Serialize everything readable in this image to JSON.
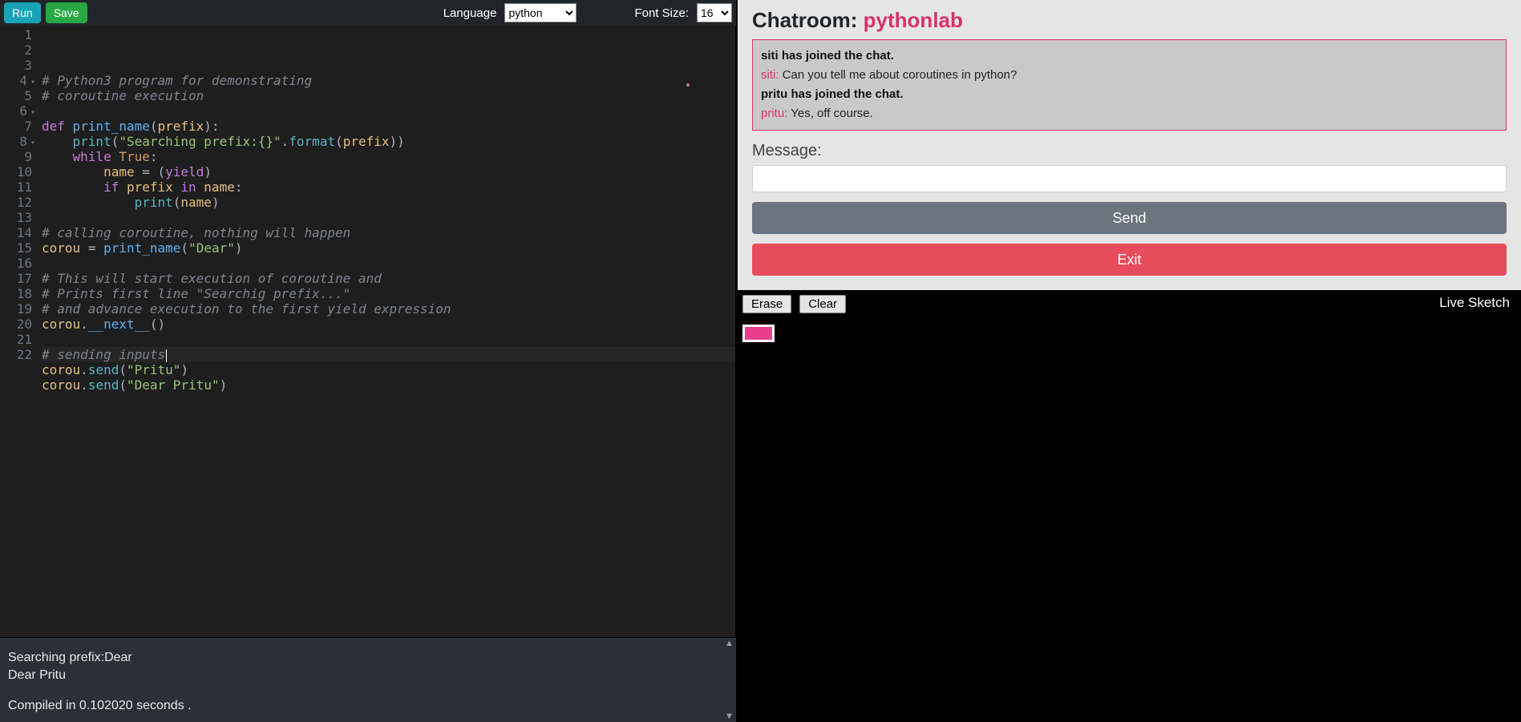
{
  "toolbar": {
    "run_label": "Run",
    "save_label": "Save",
    "language_label": "Language",
    "language_value": "python",
    "fontsize_label": "Font Size:",
    "fontsize_value": "16"
  },
  "editor": {
    "code_lines": [
      {
        "n": 1,
        "fold": false,
        "tokens": [
          [
            "cmt",
            "# Python3 program for demonstrating"
          ]
        ]
      },
      {
        "n": 2,
        "fold": false,
        "tokens": [
          [
            "cmt",
            "# coroutine execution"
          ]
        ]
      },
      {
        "n": 3,
        "fold": false,
        "tokens": []
      },
      {
        "n": 4,
        "fold": true,
        "tokens": [
          [
            "def",
            "def "
          ],
          [
            "fn",
            "print_name"
          ],
          [
            "plain",
            "("
          ],
          [
            "id",
            "prefix"
          ],
          [
            "plain",
            "):"
          ]
        ]
      },
      {
        "n": 5,
        "fold": false,
        "tokens": [
          [
            "plain",
            "    "
          ],
          [
            "call",
            "print"
          ],
          [
            "plain",
            "("
          ],
          [
            "str",
            "\"Searching prefix:{}\""
          ],
          [
            "plain",
            "."
          ],
          [
            "call",
            "format"
          ],
          [
            "plain",
            "("
          ],
          [
            "id",
            "prefix"
          ],
          [
            "plain",
            "))"
          ]
        ]
      },
      {
        "n": 6,
        "fold": true,
        "tokens": [
          [
            "plain",
            "    "
          ],
          [
            "kw",
            "while "
          ],
          [
            "const",
            "True"
          ],
          [
            "plain",
            ":"
          ]
        ]
      },
      {
        "n": 7,
        "fold": false,
        "tokens": [
          [
            "plain",
            "        "
          ],
          [
            "id",
            "name"
          ],
          [
            "plain",
            " "
          ],
          [
            "op",
            "="
          ],
          [
            "plain",
            " ("
          ],
          [
            "kw",
            "yield"
          ],
          [
            "plain",
            ")"
          ]
        ]
      },
      {
        "n": 8,
        "fold": true,
        "tokens": [
          [
            "plain",
            "        "
          ],
          [
            "kw",
            "if "
          ],
          [
            "id",
            "prefix"
          ],
          [
            "kw",
            " in "
          ],
          [
            "id",
            "name"
          ],
          [
            "plain",
            ":"
          ]
        ]
      },
      {
        "n": 9,
        "fold": false,
        "tokens": [
          [
            "plain",
            "            "
          ],
          [
            "call",
            "print"
          ],
          [
            "plain",
            "("
          ],
          [
            "id",
            "name"
          ],
          [
            "plain",
            ")"
          ]
        ]
      },
      {
        "n": 10,
        "fold": false,
        "tokens": []
      },
      {
        "n": 11,
        "fold": false,
        "tokens": [
          [
            "cmt",
            "# calling coroutine, nothing will happen"
          ]
        ]
      },
      {
        "n": 12,
        "fold": false,
        "tokens": [
          [
            "id",
            "corou"
          ],
          [
            "plain",
            " "
          ],
          [
            "op",
            "="
          ],
          [
            "plain",
            " "
          ],
          [
            "fn",
            "print_name"
          ],
          [
            "plain",
            "("
          ],
          [
            "str",
            "\"Dear\""
          ],
          [
            "plain",
            ")"
          ]
        ]
      },
      {
        "n": 13,
        "fold": false,
        "tokens": []
      },
      {
        "n": 14,
        "fold": false,
        "tokens": [
          [
            "cmt",
            "# This will start execution of coroutine and"
          ]
        ]
      },
      {
        "n": 15,
        "fold": false,
        "tokens": [
          [
            "cmt",
            "# Prints first line \"Searchig prefix...\""
          ]
        ]
      },
      {
        "n": 16,
        "fold": false,
        "tokens": [
          [
            "cmt",
            "# and advance execution to the first yield expression"
          ]
        ]
      },
      {
        "n": 17,
        "fold": false,
        "tokens": [
          [
            "id",
            "corou"
          ],
          [
            "plain",
            "."
          ],
          [
            "fn",
            "__next__"
          ],
          [
            "plain",
            "()"
          ]
        ]
      },
      {
        "n": 18,
        "fold": false,
        "tokens": []
      },
      {
        "n": 19,
        "fold": false,
        "hl": true,
        "caret": true,
        "tokens": [
          [
            "cmt",
            "# sending inputs"
          ]
        ]
      },
      {
        "n": 20,
        "fold": false,
        "tokens": [
          [
            "id",
            "corou"
          ],
          [
            "plain",
            "."
          ],
          [
            "call",
            "send"
          ],
          [
            "plain",
            "("
          ],
          [
            "str",
            "\"Pritu\""
          ],
          [
            "plain",
            ")"
          ]
        ]
      },
      {
        "n": 21,
        "fold": false,
        "tokens": [
          [
            "id",
            "corou"
          ],
          [
            "plain",
            "."
          ],
          [
            "call",
            "send"
          ],
          [
            "plain",
            "("
          ],
          [
            "str",
            "\"Dear Pritu\""
          ],
          [
            "plain",
            ")"
          ]
        ]
      },
      {
        "n": 22,
        "fold": false,
        "tokens": []
      }
    ]
  },
  "output": {
    "lines": [
      "Searching prefix:Dear",
      "Dear Pritu"
    ],
    "compiled_text": "Compiled in 0.102020 seconds ."
  },
  "chat": {
    "title_prefix": "Chatroom: ",
    "room_name": "pythonlab",
    "log": [
      {
        "type": "sys",
        "text": "siti has joined the chat."
      },
      {
        "type": "msg",
        "user": "siti",
        "text": "Can you tell me about coroutines in python?"
      },
      {
        "type": "sys",
        "text": "pritu has joined the chat."
      },
      {
        "type": "msg",
        "user": "pritu",
        "text": "Yes, off course."
      }
    ],
    "message_label": "Message:",
    "message_value": "",
    "send_label": "Send",
    "exit_label": "Exit"
  },
  "sketch": {
    "erase_label": "Erase",
    "clear_label": "Clear",
    "title": "Live Sketch",
    "swatch_color": "#e83e8c"
  }
}
